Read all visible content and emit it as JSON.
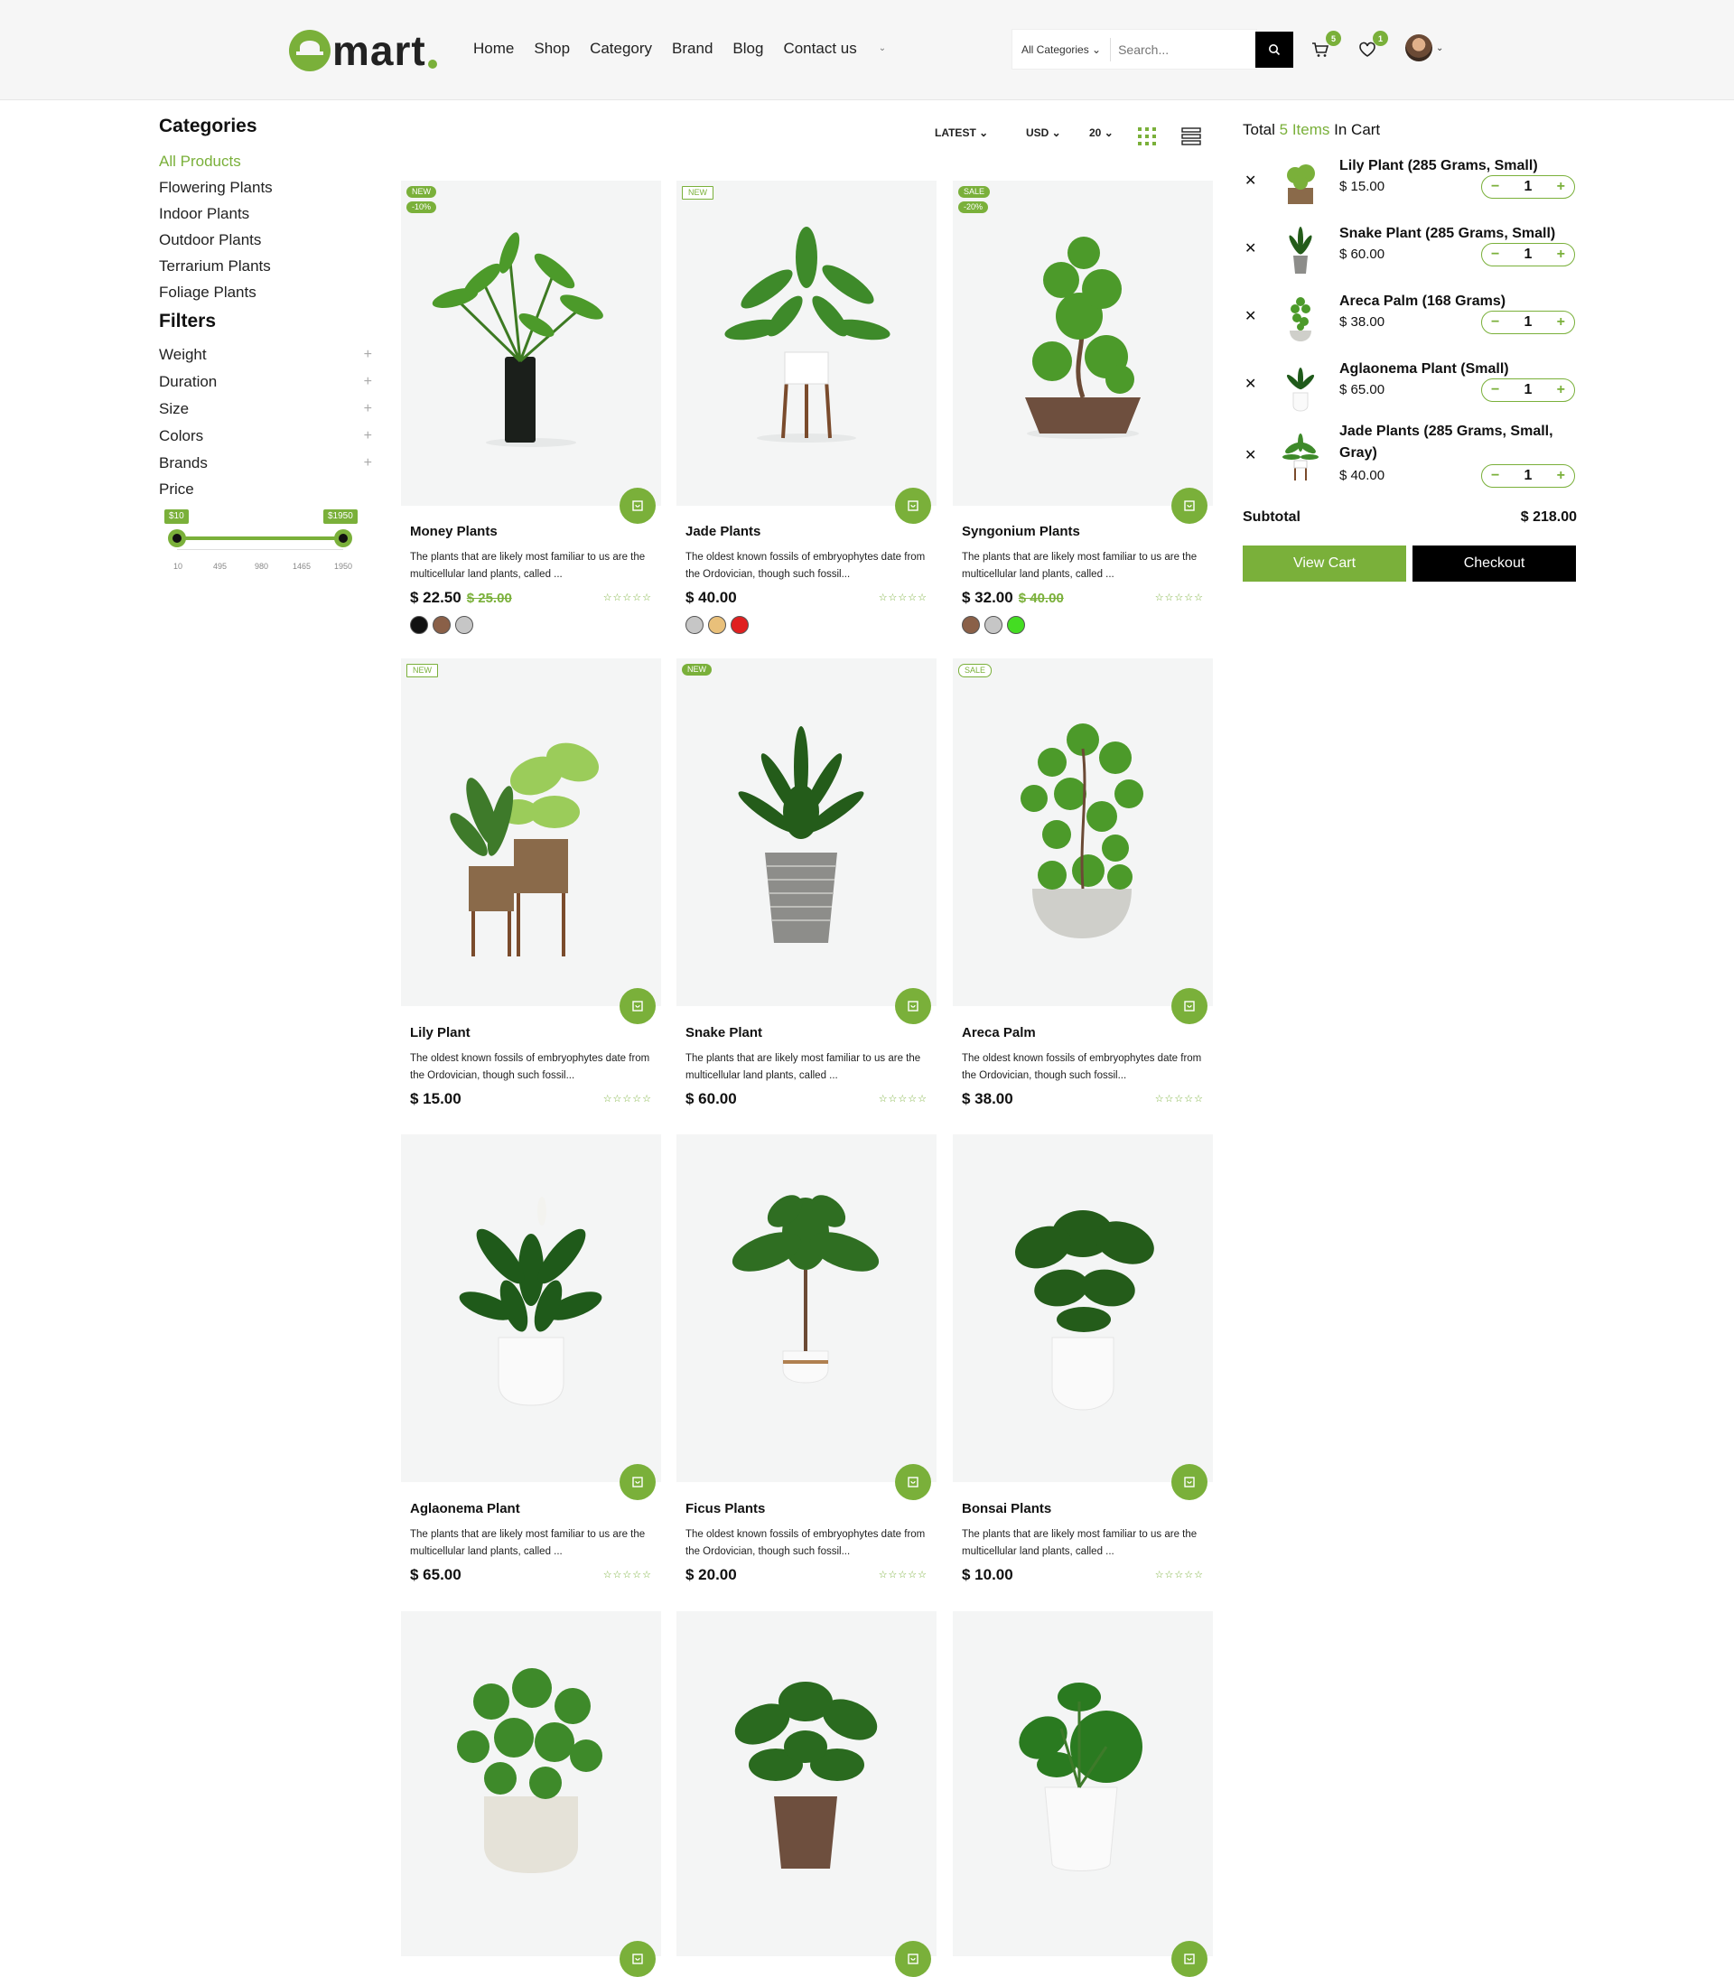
{
  "brand": {
    "logo_text": "mart",
    "accent": "#7ab03a"
  },
  "nav": {
    "items": [
      "Home",
      "Shop",
      "Category",
      "Brand",
      "Blog",
      "Contact us"
    ]
  },
  "search": {
    "category": "All Categories",
    "placeholder": "Search..."
  },
  "header": {
    "cart_count": "5",
    "wishlist_count": "1"
  },
  "sidebar": {
    "categories_title": "Categories",
    "categories": [
      "All Products",
      "Flowering Plants",
      "Indoor Plants",
      "Outdoor Plants",
      "Terrarium Plants",
      "Foliage Plants"
    ],
    "filters_title": "Filters",
    "filters": [
      "Weight",
      "Duration",
      "Size",
      "Colors",
      "Brands"
    ],
    "price_label": "Price",
    "price_min": "$10",
    "price_max": "$1950",
    "scale": [
      "10",
      "495",
      "980",
      "1465",
      "1950"
    ]
  },
  "toolbar": {
    "sort": "LATEST",
    "currency": "USD",
    "per_page": "20"
  },
  "products": [
    {
      "name": "Money Plants",
      "desc": "The plants that are likely most familiar to us are the multicellular land plants, called ...",
      "price": "$ 22.50",
      "old_price": "$ 25.00",
      "tags": [
        "NEW",
        "-10%"
      ],
      "colors": [
        "#111111",
        "#8a6048",
        "#c6c6c6"
      ],
      "stars": "☆☆☆☆☆"
    },
    {
      "name": "Jade Plants",
      "desc": "The oldest known fossils of embryophytes date from the Ordovician, though such fossil...",
      "price": "$ 40.00",
      "old_price": "",
      "tags": [
        "NEW"
      ],
      "colors": [
        "#c6c6c6",
        "#e9c07a",
        "#e02020"
      ],
      "stars": "☆☆☆☆☆"
    },
    {
      "name": "Syngonium Plants",
      "desc": "The plants that are likely most familiar to us are the multicellular land plants, called ...",
      "price": "$ 32.00",
      "old_price": "$ 40.00",
      "tags": [
        "SALE",
        "-20%"
      ],
      "colors": [
        "#8a6048",
        "#c6c6c6",
        "#44dd22"
      ],
      "stars": "☆☆☆☆☆"
    },
    {
      "name": "Lily Plant",
      "desc": "The oldest known fossils of embryophytes date from the Ordovician, though such fossil...",
      "price": "$ 15.00",
      "old_price": "",
      "tags": [
        "NEW"
      ],
      "colors": [],
      "stars": "☆☆☆☆☆"
    },
    {
      "name": "Snake Plant",
      "desc": "The plants that are likely most familiar to us are the multicellular land plants, called ...",
      "price": "$ 60.00",
      "old_price": "",
      "tags": [
        "NEW"
      ],
      "colors": [],
      "stars": "☆☆☆☆☆"
    },
    {
      "name": "Areca Palm",
      "desc": "The oldest known fossils of embryophytes date from the Ordovician, though such fossil...",
      "price": "$ 38.00",
      "old_price": "",
      "tags": [
        "SALE"
      ],
      "colors": [],
      "stars": "☆☆☆☆☆"
    },
    {
      "name": "Aglaonema Plant",
      "desc": "The plants that are likely most familiar to us are the multicellular land plants, called ...",
      "price": "$ 65.00",
      "old_price": "",
      "tags": [],
      "colors": [],
      "stars": "☆☆☆☆☆"
    },
    {
      "name": "Ficus Plants",
      "desc": "The oldest known fossils of embryophytes date from the Ordovician, though such fossil...",
      "price": "$ 20.00",
      "old_price": "",
      "tags": [],
      "colors": [],
      "stars": "☆☆☆☆☆"
    },
    {
      "name": "Bonsai Plants",
      "desc": "The plants that are likely most familiar to us are the multicellular land plants, called ...",
      "price": "$ 10.00",
      "old_price": "",
      "tags": [],
      "colors": [],
      "stars": "☆☆☆☆☆"
    }
  ],
  "cart": {
    "title_prefix": "Total",
    "title_count": "5 Items",
    "title_suffix": "In Cart",
    "items": [
      {
        "name": "Lily Plant (285 Grams, Small)",
        "price": "$ 15.00",
        "qty": "1"
      },
      {
        "name": "Snake Plant (285 Grams, Small)",
        "price": "$ 60.00",
        "qty": "1"
      },
      {
        "name": "Areca Palm (168 Grams)",
        "price": "$ 38.00",
        "qty": "1"
      },
      {
        "name": "Aglaonema Plant (Small)",
        "price": "$ 65.00",
        "qty": "1"
      },
      {
        "name": "Jade Plants (285 Grams, Small, Gray)",
        "price": "$ 40.00",
        "qty": "1"
      }
    ],
    "subtotal_label": "Subtotal",
    "subtotal": "$ 218.00",
    "view_cart": "View Cart",
    "checkout": "Checkout"
  }
}
